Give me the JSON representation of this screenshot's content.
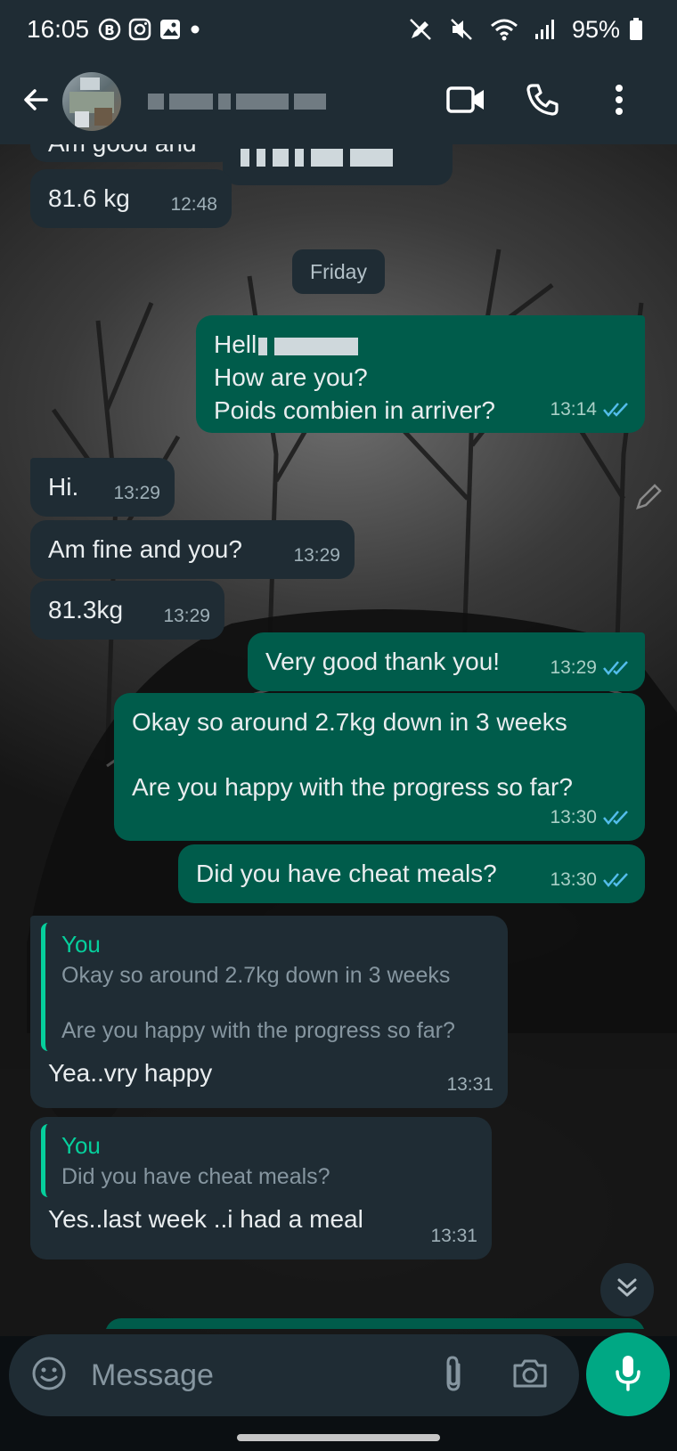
{
  "status_bar": {
    "time": "16:05",
    "battery": "95%",
    "icons": [
      "b-badge-icon",
      "instagram-icon",
      "gallery-icon",
      "dot-icon",
      "pen-off-icon",
      "mute-icon",
      "wifi-icon",
      "signal-icon",
      "battery-icon"
    ]
  },
  "header": {
    "icons": [
      "back-arrow-icon",
      "video-call-icon",
      "phone-icon",
      "more-vert-icon"
    ]
  },
  "date_divider": "Friday",
  "messages": [
    {
      "dir": "in",
      "text": "Am good and",
      "time": ""
    },
    {
      "dir": "in",
      "text": "81.6 kg",
      "time": "12:48"
    },
    {
      "dir": "out",
      "lines": [
        "Hell",
        "How are you?",
        "Poids combien in arriver?"
      ],
      "time": "13:14",
      "status": "read"
    },
    {
      "dir": "in",
      "text": "Hi.",
      "time": "13:29"
    },
    {
      "dir": "in",
      "text": "Am fine and you?",
      "time": "13:29"
    },
    {
      "dir": "in",
      "text": "81.3kg",
      "time": "13:29"
    },
    {
      "dir": "out",
      "text": "Very good thank you!",
      "time": "13:29",
      "status": "read"
    },
    {
      "dir": "out",
      "lines": [
        "Okay so around 2.7kg down in 3 weeks",
        "Are you happy with the progress so far?"
      ],
      "time": "13:30",
      "status": "read"
    },
    {
      "dir": "out",
      "text": "Did you have cheat meals?",
      "time": "13:30",
      "status": "read"
    },
    {
      "dir": "in",
      "quote": {
        "author": "You",
        "lines": [
          "Okay so around 2.7kg down in 3 weeks",
          "Are you happy with the progress so far?"
        ]
      },
      "text": "Yea..vry happy",
      "time": "13:31"
    },
    {
      "dir": "in",
      "quote": {
        "author": "You",
        "lines": [
          "Did you have cheat meals?"
        ]
      },
      "text": "Yes..last week ..i had a meal",
      "time": "13:31"
    }
  ],
  "composer": {
    "placeholder": "Message",
    "icons": [
      "emoji-icon",
      "attach-icon",
      "camera-icon",
      "mic-icon"
    ]
  },
  "colors": {
    "bar_bg": "#1f2c34",
    "incoming_bubble": "#1f2c34",
    "outgoing_bubble": "#005c4b",
    "accent": "#00a884",
    "read_tick": "#53bdeb"
  }
}
